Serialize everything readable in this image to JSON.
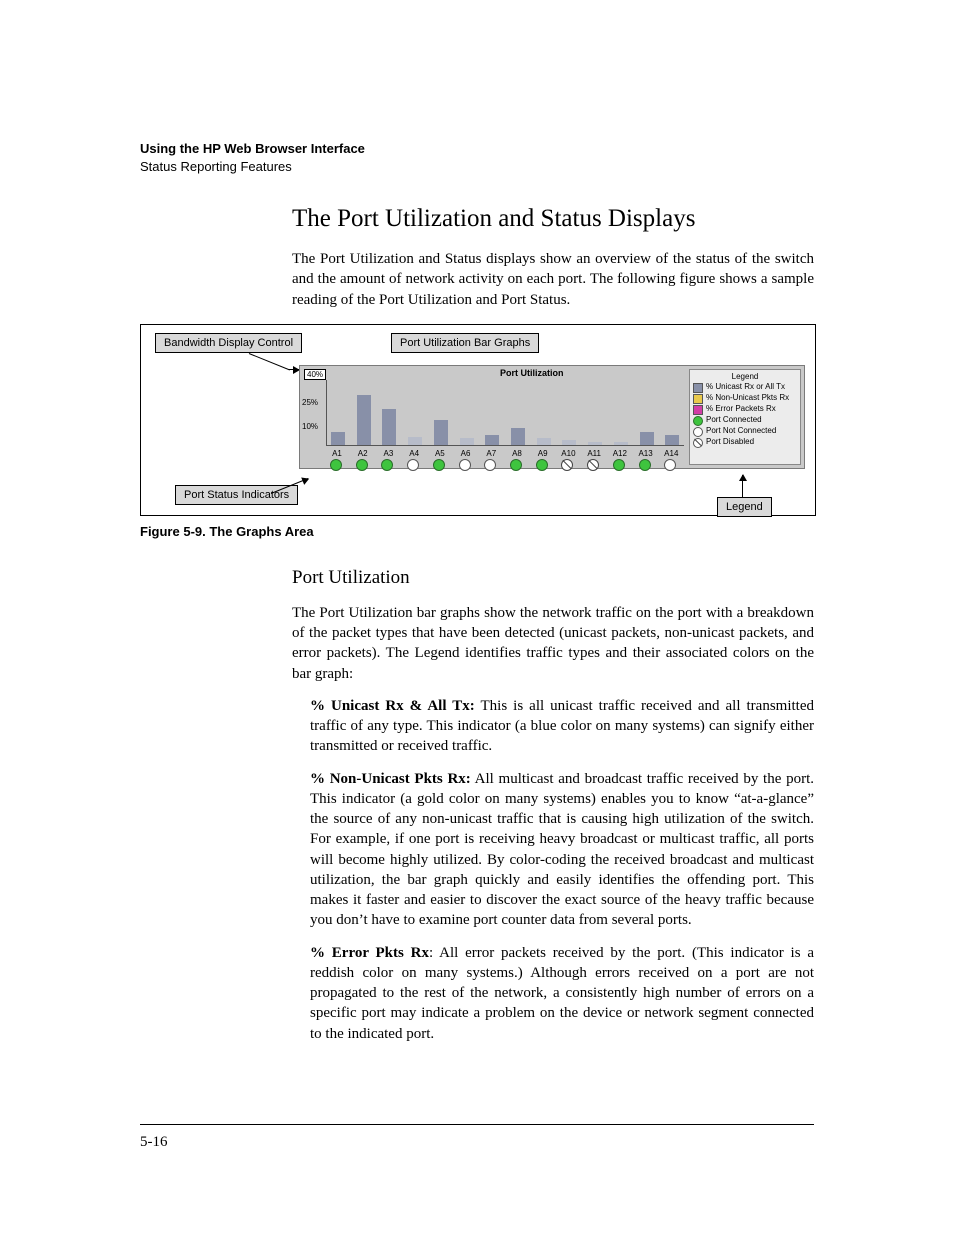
{
  "header": {
    "chapter": "Using the HP Web Browser Interface",
    "section": "Status Reporting Features"
  },
  "h2": "The Port Utilization and Status Displays",
  "intro": "The Port Utilization and Status displays show an overview of the status of the switch and the amount of network activity on each port. The following figure shows a sample reading of the Port Utilization and Port Status.",
  "figure": {
    "caption": "Figure 5-9.   The Graphs Area",
    "callouts": {
      "bw": "Bandwidth Display Control",
      "bars": "Port Utilization Bar Graphs",
      "psi": "Port Status Indicators",
      "legend": "Legend"
    }
  },
  "chart_data": {
    "type": "bar",
    "title": "Port Utilization",
    "ylabel": "%",
    "ylim": [
      0,
      40
    ],
    "yticks": [
      10,
      25,
      40
    ],
    "scale_selector": "40%",
    "categories": [
      "A1",
      "A2",
      "A3",
      "A4",
      "A5",
      "A6",
      "A7",
      "A8",
      "A9",
      "A10",
      "A11",
      "A12",
      "A13",
      "A14"
    ],
    "series": [
      {
        "name": "% Unicast Rx or All Tx",
        "color": "#8890a8",
        "values": [
          8,
          30,
          22,
          5,
          15,
          4,
          6,
          10,
          4,
          3,
          2,
          2,
          8,
          6
        ]
      }
    ],
    "port_status": [
      "connected",
      "connected",
      "connected",
      "not_connected",
      "connected",
      "not_connected",
      "not_connected",
      "connected",
      "connected",
      "disabled",
      "disabled",
      "connected",
      "connected",
      "not_connected"
    ],
    "legend": {
      "title": "Legend",
      "items": [
        {
          "swatch": "blue",
          "label": "% Unicast Rx or All Tx"
        },
        {
          "swatch": "gold",
          "label": "% Non-Unicast Pkts Rx"
        },
        {
          "swatch": "mag",
          "label": "% Error Packets Rx"
        },
        {
          "swatch": "dot",
          "label": "Port Connected"
        },
        {
          "swatch": "dotnc",
          "label": "Port Not Connected"
        },
        {
          "swatch": "dotdis",
          "label": "Port Disabled"
        }
      ]
    }
  },
  "h3": "Port Utilization",
  "para2": "The Port Utilization bar graphs show the network traffic on the port with a breakdown of the packet types that have been detected (unicast packets, non-unicast packets, and error packets). The Legend identifies traffic types and their associated colors on the bar graph:",
  "bullets": [
    {
      "lead": "% Unicast Rx & All Tx:",
      "text": " This is all unicast traffic received and all transmitted traffic of any type. This indicator (a blue color on many systems) can signify either transmitted or received traffic."
    },
    {
      "lead": "% Non-Unicast Pkts Rx:",
      "text": " All multicast and broadcast traffic received by the port. This indicator (a gold color on many systems) enables you to know “at-a-glance” the source of any non-unicast traffic that is causing high utilization of the switch. For example, if one port is receiving heavy broadcast or multicast traffic, all ports will become highly utilized. By color-coding the received broadcast and multicast utilization, the bar graph quickly and easily identifies the offending port. This makes it faster and easier to discover the exact source of the heavy traffic because you don’t have to examine port counter data from several ports."
    },
    {
      "lead": "% Error Pkts Rx",
      "text": ": All error packets received by the port. (This indicator is a reddish color on many systems.) Although errors received on a port are not propagated to the rest of the network, a consistently high number of errors on a specific port may indicate a problem on the device or network segment connected to the indicated port."
    }
  ],
  "page_number": "5-16"
}
